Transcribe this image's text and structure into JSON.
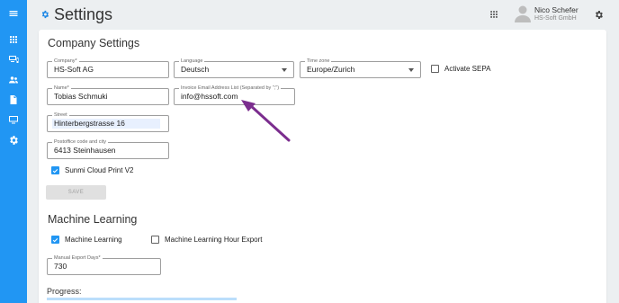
{
  "header": {
    "title": "Settings",
    "user_name": "Nico Schefer",
    "user_company": "HS-Soft GmbH"
  },
  "sidebar": {
    "items": [
      {
        "icon": "menu-icon"
      },
      {
        "icon": "apps-grid-icon"
      },
      {
        "icon": "devices-icon"
      },
      {
        "icon": "people-icon"
      },
      {
        "icon": "document-icon"
      },
      {
        "icon": "monitor-icon"
      },
      {
        "icon": "settings-icon"
      }
    ]
  },
  "company": {
    "section_title": "Company Settings",
    "company_label": "Company*",
    "company_value": "HS-Soft AG",
    "language_label": "Language",
    "language_value": "Deutsch",
    "timezone_label": "Time zone",
    "timezone_value": "Europe/Zurich",
    "sepa_label": "Activate SEPA",
    "sepa_checked": false,
    "name_label": "Name*",
    "name_value": "Tobias Schmuki",
    "invoice_email_label": "Invoice Email Address List (Separated by \";\")",
    "invoice_email_value": "info@hssoft.com",
    "street_label": "Street",
    "street_value": "Hinterbergstrasse 16",
    "postoffice_label": "Postoffice code and city",
    "postoffice_value": "6413 Steinhausen",
    "sunmi_label": "Sunmi Cloud Print V2",
    "sunmi_checked": true,
    "save_label": "SAVE"
  },
  "machine_learning": {
    "section_title": "Machine Learning",
    "ml_label": "Machine Learning",
    "ml_checked": true,
    "ml_hour_export_label": "Machine Learning Hour Export",
    "ml_hour_export_checked": false,
    "export_days_label": "Manual Export Days*",
    "export_days_value": "730",
    "progress_label": "Progress:"
  },
  "colors": {
    "accent": "#2196f3",
    "annotation_arrow": "#7b2d8e"
  }
}
